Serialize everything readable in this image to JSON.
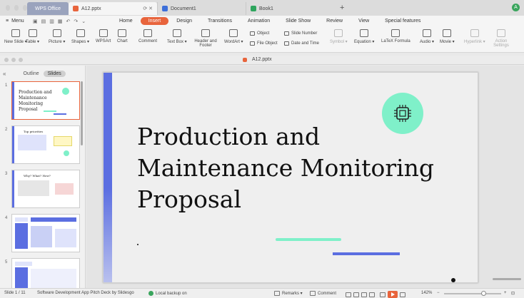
{
  "tabbar": {
    "wps_label": "WPS Office",
    "tabs": [
      {
        "label": "A12.pptx",
        "color": "#e8643c"
      },
      {
        "label": "Document1",
        "color": "#3d6fd9"
      },
      {
        "label": "Book1",
        "color": "#2ea55d"
      }
    ],
    "avatar_letter": "A"
  },
  "menubar": {
    "menu_label": "Menu",
    "tabs": [
      "Home",
      "Insert",
      "Design",
      "Transitions",
      "Animation",
      "Slide Show",
      "Review",
      "View",
      "Special features"
    ],
    "active_tab": "Insert"
  },
  "ribbon": {
    "new_slide": "New Slide ▾",
    "table": "Table ▾",
    "picture": "Picture ▾",
    "shapes": "Shapes ▾",
    "wpsart": "WPSArt",
    "chart": "Chart",
    "comment": "Comment",
    "textbox": "Text Box ▾",
    "header_footer": "Header and Footer",
    "wordart": "WordArt ▾",
    "object": "Object",
    "file_object": "File Object",
    "slide_number": "Slide Number",
    "date_time": "Date and Time",
    "symbol": "Symbol ▾",
    "equation": "Equation ▾",
    "latex": "LaTeX Formula",
    "audio": "Audio ▾",
    "movie": "Movie ▾",
    "hyperlink": "Hyperlink ▾",
    "action_settings": "Action Settings"
  },
  "docbar": {
    "title": "A12.pptx"
  },
  "leftpane": {
    "tabs": [
      "Outline",
      "Slides"
    ],
    "active_tab": "Slides",
    "thumbnails": [
      {
        "num": "1",
        "title": "Production and Maintenance Monitoring Proposal"
      },
      {
        "num": "2",
        "title": "Top priorities"
      },
      {
        "num": "3",
        "title": "Why? What? How?"
      },
      {
        "num": "4",
        "title": ""
      },
      {
        "num": "5",
        "title": ""
      }
    ]
  },
  "slide": {
    "title": "Production and Maintenance Monitoring Proposal",
    "accent_color": "#5b6ee1",
    "mint_color": "#7ff0c9"
  },
  "statusbar": {
    "slide_info": "Slide 1 / 11",
    "theme": "Software Development App Pitch Deck by Slidesgo",
    "backup": "Local backup on",
    "remarks": "Remarks ▾",
    "comment": "Comment",
    "zoom": "142%"
  }
}
